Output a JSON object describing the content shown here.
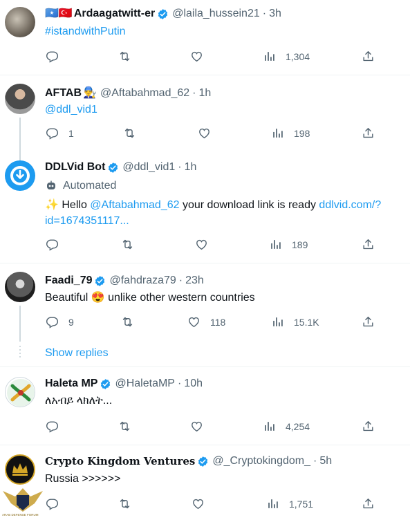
{
  "posts": [
    {
      "name": "Ardaagatwitt-er",
      "flags": "🇸🇴🇹🇷",
      "handle": "@laila_hussein21",
      "time": "3h",
      "text_link": "#istandwithPutin",
      "stats": {
        "replies": "",
        "reposts": "",
        "likes": "",
        "views": "1,304"
      }
    },
    {
      "name": "AFTAB",
      "name_emoji": "👨‍🔧",
      "handle": "@Aftabahmad_62",
      "time": "1h",
      "text_link": "@ddl_vid1",
      "stats": {
        "replies": "1",
        "reposts": "",
        "likes": "",
        "views": "198"
      }
    },
    {
      "name": "DDLVid Bot",
      "handle": "@ddl_vid1",
      "time": "1h",
      "automated_label": "Automated",
      "text_emoji": "✨",
      "text_pre": "Hello",
      "text_mention": "@Aftabahmad_62",
      "text_mid": "your download link is ready",
      "text_url": "ddlvid.com/?",
      "text_url2": "id=1674351117...",
      "stats": {
        "replies": "",
        "reposts": "",
        "likes": "",
        "views": "189"
      }
    },
    {
      "name": "Faadi_79",
      "handle": "@fahdraza79",
      "time": "23h",
      "text_pre": "Beautiful",
      "text_emoji": "😍",
      "text_post": "unlike other western countries",
      "stats": {
        "replies": "9",
        "reposts": "",
        "likes": "118",
        "views": "15.1K"
      }
    },
    {
      "name": "Haleta MP",
      "handle": "@HaletaMP",
      "time": "10h",
      "text": "ለአብይ ላክለት...",
      "stats": {
        "replies": "",
        "reposts": "",
        "likes": "",
        "views": "4,254"
      }
    },
    {
      "name": "Crypto Kingdom Ventures",
      "handle": "@_Cryptokingdom_",
      "time": "5h",
      "text": "Russia >>>>>>",
      "stats": {
        "replies": "",
        "reposts": "",
        "likes": "",
        "views": "1,751"
      }
    }
  ],
  "show_replies": "Show replies",
  "dot": "·",
  "watermark": {
    "top": "DA",
    "bottom": "ARAB DEFENSE FORUM"
  },
  "colors": {
    "link": "#1d9bf0",
    "verified": "#1d9bf0",
    "muted": "#536471",
    "divider": "#eff3f4"
  }
}
